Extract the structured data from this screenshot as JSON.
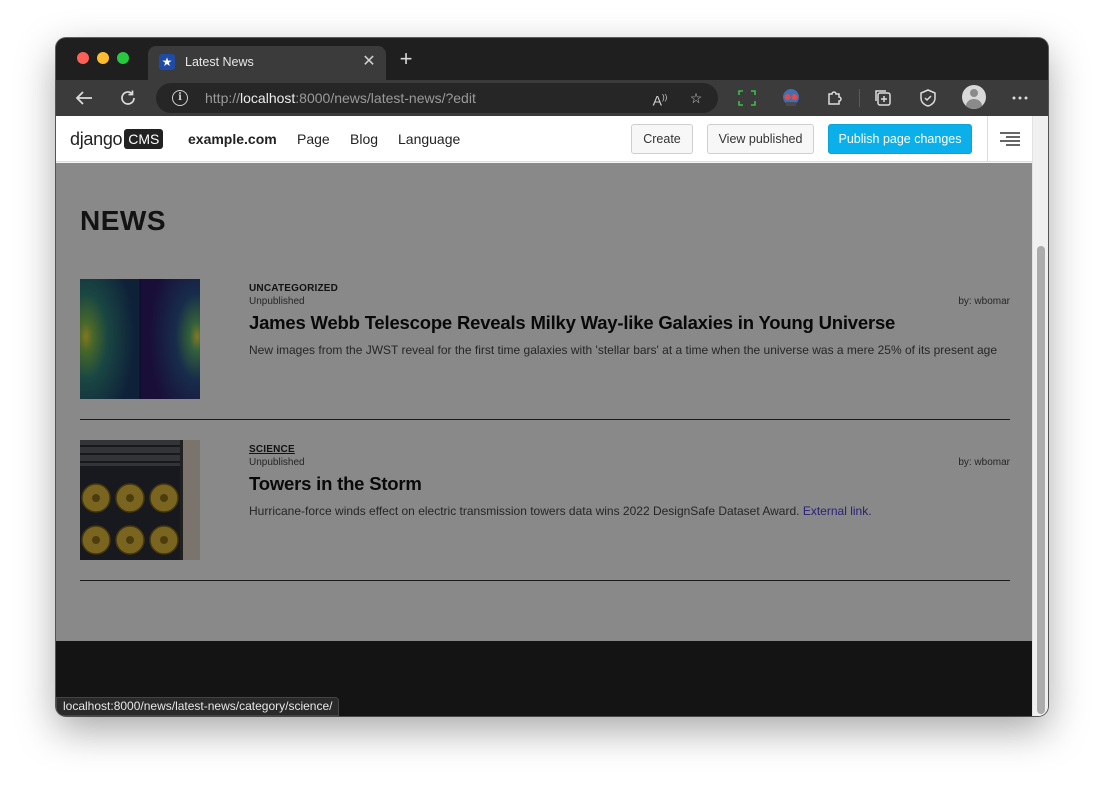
{
  "browser": {
    "tab_title": "Latest News",
    "url_prefix": "http://",
    "url_host": "localhost",
    "url_rest": ":8000/news/latest-news/?edit",
    "status_url": "localhost:8000/news/latest-news/category/science/"
  },
  "cms": {
    "logo_text": "django",
    "logo_box": "CMS",
    "site": "example.com",
    "nav": [
      "Page",
      "Blog",
      "Language"
    ],
    "create_label": "Create",
    "view_published_label": "View published",
    "publish_label": "Publish page changes",
    "colors": {
      "primary": "#0bb0ea"
    }
  },
  "page": {
    "title": "NEWS",
    "articles": [
      {
        "category": "UNCATEGORIZED",
        "status": "Unpublished",
        "author": "by: wbomar",
        "title": "James Webb Telescope Reveals Milky Way-like Galaxies in Young Universe",
        "description": "New images from the JWST reveal for the first time galaxies with 'stellar bars' at a time when the universe was a mere 25% of its present age",
        "link_text": ""
      },
      {
        "category": "SCIENCE",
        "status": "Unpublished",
        "author": "by: wbomar",
        "title": "Towers in the Storm",
        "description": "Hurricane-force winds effect on electric transmission towers data wins 2022 DesignSafe Dataset Award.",
        "link_text": "External link."
      }
    ]
  }
}
